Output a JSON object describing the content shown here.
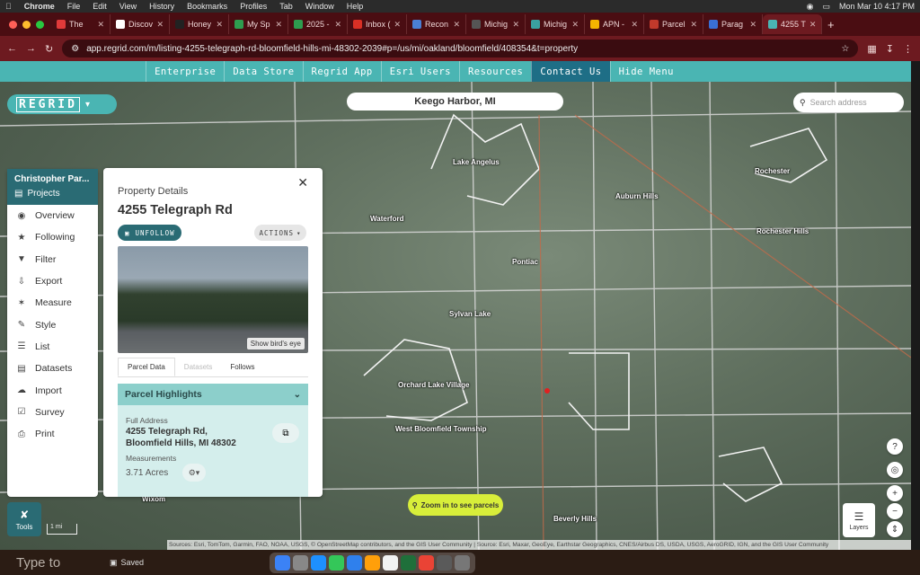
{
  "menubar": {
    "app": "Chrome",
    "items": [
      "File",
      "Edit",
      "View",
      "History",
      "Bookmarks",
      "Profiles",
      "Tab",
      "Window",
      "Help"
    ],
    "clock": "Mon Mar 10  4:17 PM"
  },
  "tabs": [
    {
      "label": "The",
      "color": "#e03a3a"
    },
    {
      "label": "Discov",
      "color": "#ffffff"
    },
    {
      "label": "Honey",
      "color": "#222222"
    },
    {
      "label": "My Sp",
      "color": "#2e9d4f"
    },
    {
      "label": "2025 -",
      "color": "#2e9d4f"
    },
    {
      "label": "Inbox (",
      "color": "#d93025"
    },
    {
      "label": "Recon",
      "color": "#4a7fd4"
    },
    {
      "label": "Michig",
      "color": "#555555"
    },
    {
      "label": "Michig",
      "color": "#3aa0a0"
    },
    {
      "label": "APN -",
      "color": "#f4b400"
    },
    {
      "label": "Parcel",
      "color": "#c0392b"
    },
    {
      "label": "Parag",
      "color": "#3a6fd4"
    },
    {
      "label": "4255 T",
      "color": "#4ab5b3",
      "active": true
    }
  ],
  "address": {
    "url": "app.regrid.com/m/listing-4255-telegraph-rd-bloomfield-hills-mi-48302-2039#p=/us/mi/oakland/bloomfield/408354&t=property"
  },
  "topnav": [
    {
      "label": "Enterprise"
    },
    {
      "label": "Data Store"
    },
    {
      "label": "Regrid App"
    },
    {
      "label": "Esri Users"
    },
    {
      "label": "Resources"
    },
    {
      "label": "Contact Us",
      "active": true
    },
    {
      "label": "Hide Menu"
    }
  ],
  "logo": {
    "text": "REGRID"
  },
  "location": {
    "title": "Keego Harbor, MI"
  },
  "search": {
    "placeholder": "Search address"
  },
  "sidebar": {
    "user": "Christopher Par...",
    "projects": "Projects",
    "items": [
      {
        "label": "Overview",
        "icon": "map-pin-icon"
      },
      {
        "label": "Following",
        "icon": "star-icon"
      },
      {
        "label": "Filter",
        "icon": "filter-icon"
      },
      {
        "label": "Export",
        "icon": "download-icon"
      },
      {
        "label": "Measure",
        "icon": "ruler-icon"
      },
      {
        "label": "Style",
        "icon": "brush-icon"
      },
      {
        "label": "List",
        "icon": "list-icon"
      },
      {
        "label": "Datasets",
        "icon": "database-icon"
      },
      {
        "label": "Import",
        "icon": "cloud-upload-icon"
      },
      {
        "label": "Survey",
        "icon": "checkbox-icon"
      },
      {
        "label": "Print",
        "icon": "printer-icon"
      }
    ]
  },
  "panel": {
    "label": "Property Details",
    "address": "4255 Telegraph Rd",
    "unfollow": "UNFOLLOW",
    "actions": "ACTIONS",
    "photo_button": "Show bird's eye",
    "tabs": [
      {
        "label": "Parcel Data",
        "active": true
      },
      {
        "label": "Datasets",
        "disabled": true
      },
      {
        "label": "Follows"
      }
    ],
    "highlights": {
      "title": "Parcel Highlights",
      "full_address_label": "Full Address",
      "full_address_line1": "4255 Telegraph Rd,",
      "full_address_line2": "Bloomfield Hills, MI 48302",
      "measurements_label": "Measurements",
      "acres": "3.71 Acres"
    }
  },
  "map_labels": [
    "Lake Angelus",
    "Waterford",
    "Auburn Hills",
    "Rochester",
    "Rochester Hills",
    "Pontiac",
    "Sylvan Lake",
    "Orchard Lake Village",
    "West Bloomfield Township",
    "Wixom",
    "Beverly Hills"
  ],
  "tools": {
    "label": "Tools"
  },
  "scale": {
    "label": "1 mi"
  },
  "zoom_hint": {
    "label": "Zoom in to see parcels"
  },
  "layers": {
    "label": "Layers"
  },
  "attribution": "Sources: Esri, TomTom, Garmin, FAO, NOAA, USGS, © OpenStreetMap contributors, and the GIS User Community | Source: Esri, Maxar, GeoEye, Earthstar Geographics, CNES/Airbus DS, USDA, USGS, AeroGRID, IGN, and the GIS User Community",
  "dock": {
    "typeto": "Type to",
    "saved": "Saved"
  }
}
